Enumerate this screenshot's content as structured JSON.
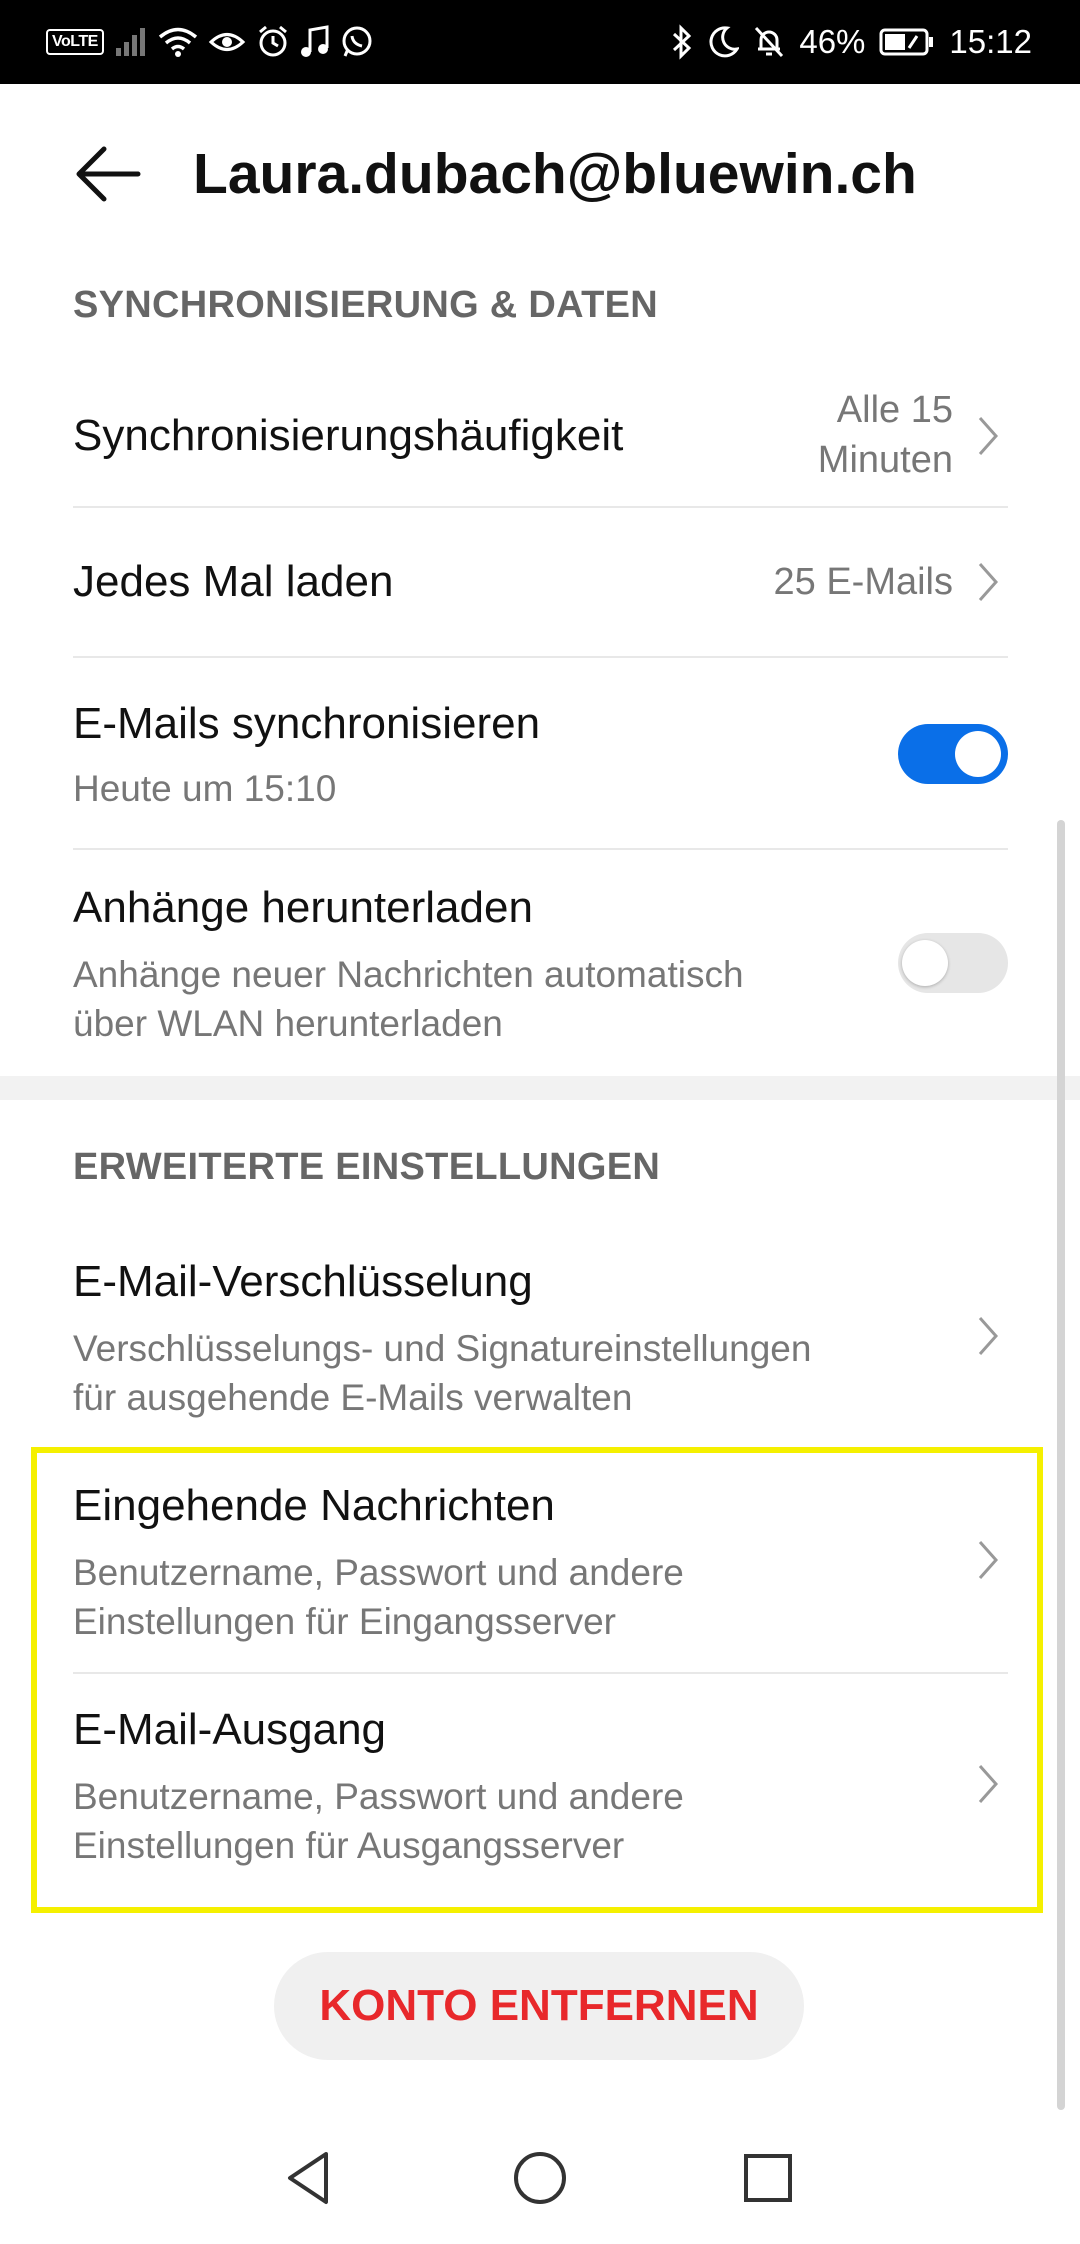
{
  "status_bar": {
    "volte": "VoLTE",
    "battery": "46%",
    "time": "15:12"
  },
  "header": {
    "title": "Laura.dubach@bluewin.ch"
  },
  "sync_section": {
    "label": "SYNCHRONISIERUNG & DATEN",
    "frequency": {
      "title": "Synchronisierungshäufigkeit",
      "value_line1": "Alle 15",
      "value_line2": "Minuten"
    },
    "load": {
      "title": "Jedes Mal laden",
      "value": "25 E-Mails"
    },
    "sync_emails": {
      "title": "E-Mails synchronisieren",
      "subtitle": "Heute um 15:10",
      "enabled": true
    },
    "attachments": {
      "title": "Anhänge herunterladen",
      "subtitle_line1": "Anhänge neuer Nachrichten automatisch",
      "subtitle_line2": "über WLAN herunterladen",
      "enabled": false
    }
  },
  "advanced_section": {
    "label": "ERWEITERTE EINSTELLUNGEN",
    "encryption": {
      "title": "E-Mail-Verschlüsselung",
      "subtitle_line1": "Verschlüsselungs- und Signatureinstellungen",
      "subtitle_line2": "für ausgehende E-Mails verwalten"
    },
    "incoming": {
      "title": "Eingehende Nachrichten",
      "subtitle_line1": "Benutzername, Passwort und andere",
      "subtitle_line2": "Einstellungen für Eingangsserver"
    },
    "outgoing": {
      "title": "E-Mail-Ausgang",
      "subtitle_line1": "Benutzername, Passwort und andere",
      "subtitle_line2": "Einstellungen für Ausgangsserver"
    }
  },
  "remove_account": {
    "label": "KONTO ENTFERNEN"
  },
  "colors": {
    "accent": "#0a6fe8",
    "danger": "#e8282b",
    "highlight": "#f5f000"
  },
  "icons": [
    "back-arrow-icon",
    "chevron-right-icon",
    "nav-back-icon",
    "nav-home-icon",
    "nav-recents-icon",
    "wifi-icon",
    "signal-icon",
    "bluetooth-icon",
    "moon-icon",
    "alarm-icon",
    "battery-icon"
  ]
}
